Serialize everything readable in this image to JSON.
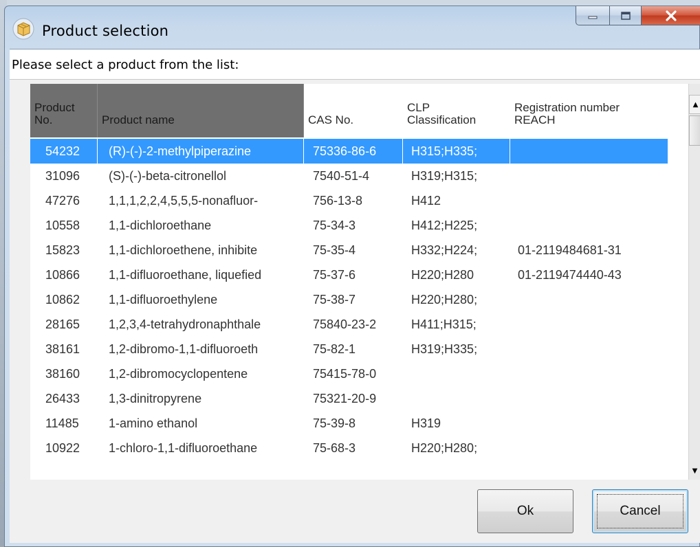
{
  "window": {
    "title": "Product selection",
    "icon": "package-icon"
  },
  "prompt": "Please select a product from the list:",
  "table": {
    "columns": [
      "Product\nNo.",
      "Product name",
      "CAS No.",
      "CLP\nClassification",
      "Registration number\nREACH"
    ],
    "rows": [
      [
        "54232",
        "(R)-(-)-2-methylpiperazine",
        "75336-86-6",
        "H315;H335;",
        ""
      ],
      [
        "31096",
        "(S)-(-)-beta-citronellol",
        "7540-51-4",
        "H319;H315;",
        ""
      ],
      [
        "47276",
        "1,1,1,2,2,4,5,5,5-nonafluor-",
        "756-13-8",
        "H412",
        ""
      ],
      [
        "10558",
        "1,1-dichloroethane",
        "75-34-3",
        "H412;H225;",
        ""
      ],
      [
        "15823",
        "1,1-dichloroethene, inhibite",
        "75-35-4",
        "H332;H224;",
        "01-2119484681-31"
      ],
      [
        "10866",
        "1,1-difluoroethane, liquefied",
        "75-37-6",
        "H220;H280",
        "01-2119474440-43"
      ],
      [
        "10862",
        "1,1-difluoroethylene",
        "75-38-7",
        "H220;H280;",
        ""
      ],
      [
        "28165",
        "1,2,3,4-tetrahydronaphthale",
        "75840-23-2",
        "H411;H315;",
        ""
      ],
      [
        "38161",
        "1,2-dibromo-1,1-difluoroeth",
        "75-82-1",
        "H319;H335;",
        ""
      ],
      [
        "38160",
        "1,2-dibromocyclopentene",
        "75415-78-0",
        "",
        ""
      ],
      [
        "26433",
        "1,3-dinitropyrene",
        "75321-20-9",
        "",
        ""
      ],
      [
        "11485",
        "1-amino ethanol",
        "75-39-8",
        "H319",
        ""
      ],
      [
        "10922",
        "1-chloro-1,1-difluoroethane",
        "75-68-3",
        "H220;H280;",
        ""
      ]
    ],
    "selected_row": 0
  },
  "buttons": {
    "ok": "Ok",
    "cancel": "Cancel"
  },
  "colors": {
    "selection": "#3399ff",
    "header_dark": "#6f6f6f"
  }
}
